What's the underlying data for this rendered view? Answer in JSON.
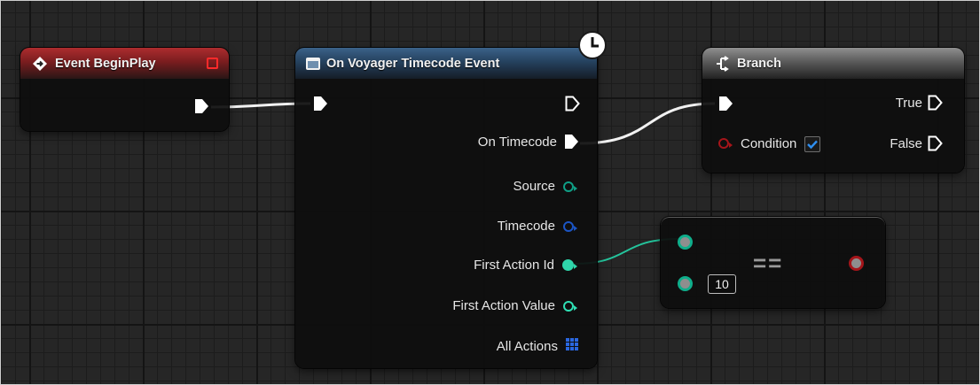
{
  "event_beginplay": {
    "title": "Event BeginPlay",
    "icon": "event-diamond-icon",
    "delegate_icon": "delegate-pin-icon",
    "header_color": "#9c2a2c"
  },
  "voyager": {
    "title": "On Voyager Timecode Event",
    "icon": "function-window-icon",
    "latent_icon": "clock-icon",
    "header_color": "#2f5578",
    "outputs": {
      "on_timecode": "On Timecode",
      "source": "Source",
      "timecode": "Timecode",
      "first_action_id": "First Action Id",
      "first_action_value": "First Action Value",
      "all_actions": "All Actions"
    },
    "pin_colors": {
      "source": "#0f9f86",
      "timecode": "#1b55c5",
      "first_action_id": "#2fd6ab",
      "first_action_value": "#2fe0b5",
      "all_actions": "#2a67e0"
    }
  },
  "branch": {
    "title": "Branch",
    "icon": "branch-icon",
    "true_label": "True",
    "false_label": "False",
    "condition_label": "Condition",
    "condition_checked": true,
    "condition_pin_color": "#a5151a",
    "header_color": "#7a7a7a"
  },
  "equals": {
    "symbol": "==",
    "default_value": "10",
    "input_pin_color": "#0fae8b",
    "output_pin_color": "#a5151a"
  }
}
